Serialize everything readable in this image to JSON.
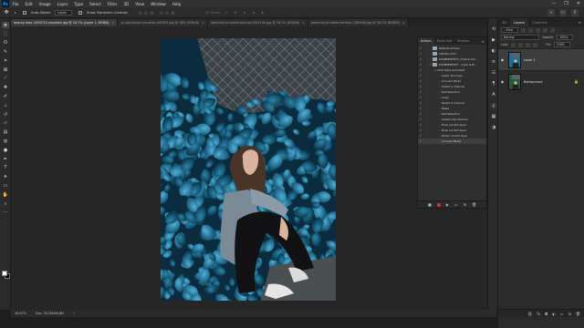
{
  "app": {
    "logo_text": "Ps"
  },
  "menu": [
    "File",
    "Edit",
    "Image",
    "Layer",
    "Type",
    "Select",
    "Filter",
    "3D",
    "View",
    "Window",
    "Help"
  ],
  "window_controls": [
    "—",
    "❐",
    "✕"
  ],
  "options_bar": {
    "auto_select_label": "Auto-Select:",
    "auto_select_target": "Layer",
    "show_transform_label": "Show Transform Controls",
    "mode_3d_label": "3D Mode:"
  },
  "document_tabs": [
    {
      "title": "beauty-lean-1455213.unsplash.jpg @ 16.7% (Layer 1, RGB/8)",
      "active": true
    },
    {
      "title": "an-attractive-brunette-490381.jpg @ 16% (RGB/8)",
      "active": false
    },
    {
      "title": "beautiful-brunette-blonde-1542139.jpg @ 16.7% (RGB/8)",
      "active": false
    },
    {
      "title": "beautiful-brunette-female-1264948.jpg @ 16.7% (RGB/8)",
      "active": false
    }
  ],
  "status_bar": {
    "zoom": "16.67%",
    "doc_size": "Doc: 35.2M/66.8M"
  },
  "colors": {
    "foreground": "#ffffff",
    "background": "#000000",
    "accent": "#2f7fb8"
  },
  "tools": [
    "move-icon",
    "marquee-icon",
    "lasso-icon",
    "quick-select-icon",
    "crop-icon",
    "frame-icon",
    "eyedropper-icon",
    "healing-icon",
    "brush-icon",
    "clone-stamp-icon",
    "history-brush-icon",
    "eraser-icon",
    "gradient-icon",
    "blur-icon",
    "dodge-icon",
    "pen-icon",
    "type-icon",
    "path-select-icon",
    "rectangle-icon",
    "hand-icon",
    "zoom-icon",
    "more-tools-icon"
  ],
  "actions_panel": {
    "tabs": [
      "Actions",
      "Brush Sett",
      "Brushes"
    ],
    "rows": [
      {
        "text": "Default Actions",
        "indent": 0,
        "kind": "set",
        "expanded": false
      },
      {
        "text": "Infinite Color",
        "indent": 0,
        "kind": "set",
        "expanded": false
      },
      {
        "text": "PIXIMPERFECT | Frame Art...",
        "indent": 0,
        "kind": "set",
        "expanded": false
      },
      {
        "text": "PIXIMPERFECT - Cyan & B...",
        "indent": 0,
        "kind": "set",
        "expanded": true
      },
      {
        "text": "Click Here and Start",
        "indent": 1,
        "kind": "action",
        "expanded": true
      },
      {
        "text": "Layer Via Copy",
        "indent": 2,
        "kind": "step",
        "expanded": false
      },
      {
        "text": "Convert Mode",
        "indent": 2,
        "kind": "step",
        "expanded": false
      },
      {
        "text": "Select a channel",
        "indent": 2,
        "kind": "step",
        "expanded": false
      },
      {
        "text": "Set Selection",
        "indent": 2,
        "kind": "step",
        "expanded": false
      },
      {
        "text": "Copy",
        "indent": 2,
        "kind": "step",
        "expanded": false
      },
      {
        "text": "Select a channel",
        "indent": 2,
        "kind": "step",
        "expanded": false
      },
      {
        "text": "Paste",
        "indent": 2,
        "kind": "step",
        "expanded": false
      },
      {
        "text": "Set Selection",
        "indent": 2,
        "kind": "step",
        "expanded": false
      },
      {
        "text": "Select Lab channel",
        "indent": 2,
        "kind": "step",
        "expanded": false
      },
      {
        "text": "Hide current layer",
        "indent": 2,
        "kind": "step",
        "expanded": false
      },
      {
        "text": "Hide current layer",
        "indent": 2,
        "kind": "step",
        "expanded": false
      },
      {
        "text": "Show current layer",
        "indent": 2,
        "kind": "step",
        "expanded": false
      },
      {
        "text": "Convert Mode",
        "indent": 2,
        "kind": "step",
        "expanded": false,
        "selected": true
      }
    ],
    "footer_icons": [
      "stop-icon",
      "record-icon",
      "play-icon",
      "new-set-icon",
      "new-action-icon",
      "delete-icon"
    ]
  },
  "right_strip": [
    "history-icon",
    "play-action-icon",
    "adjustments-icon",
    "properties-icon",
    "libraries-icon",
    "paragraph-icon",
    "character-icon",
    "glyphs-icon",
    "swatch-icon",
    "color-icon"
  ],
  "layers_panel": {
    "tabs": [
      "3D",
      "Layers",
      "Channels"
    ],
    "filter_label": "Kind",
    "blend_mode": "Normal",
    "opacity_label": "Opacity:",
    "opacity_value": "100%",
    "lock_label": "Lock:",
    "fill_label": "Fill:",
    "fill_value": "100%",
    "layers": [
      {
        "name": "Layer 1",
        "selected": true,
        "italic": false,
        "locked": false
      },
      {
        "name": "Background",
        "selected": false,
        "italic": true,
        "locked": true
      }
    ],
    "footer_icons": [
      "link-icon",
      "fx-icon",
      "mask-icon",
      "adjustment-layer-icon",
      "group-icon",
      "new-layer-icon",
      "trash-icon"
    ]
  }
}
